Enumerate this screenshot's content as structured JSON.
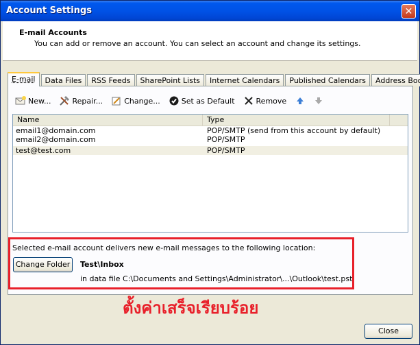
{
  "window": {
    "title": "Account Settings"
  },
  "header": {
    "title": "E-mail Accounts",
    "subtitle": "You can add or remove an account. You can select an account and change its settings."
  },
  "tabs": [
    {
      "label": "E-mail",
      "active": true
    },
    {
      "label": "Data Files"
    },
    {
      "label": "RSS Feeds"
    },
    {
      "label": "SharePoint Lists"
    },
    {
      "label": "Internet Calendars"
    },
    {
      "label": "Published Calendars"
    },
    {
      "label": "Address Books"
    }
  ],
  "toolbar": {
    "new": "New...",
    "repair": "Repair...",
    "change": "Change...",
    "set_default": "Set as Default",
    "remove": "Remove"
  },
  "list": {
    "headers": {
      "name": "Name",
      "type": "Type"
    },
    "rows": [
      {
        "name": "email1@domain.com",
        "type": "POP/SMTP (send from this account by default)"
      },
      {
        "name": "email2@domain.com",
        "type": "POP/SMTP"
      },
      {
        "name": "test@test.com",
        "type": "POP/SMTP",
        "selected": true
      }
    ]
  },
  "delivery": {
    "label": "Selected e-mail account delivers new e-mail messages to the following location:",
    "change_folder_button": "Change Folder",
    "folder": "Test\\Inbox",
    "path": "in data file C:\\Documents and Settings\\Administrator\\...\\Outlook\\test.pst"
  },
  "annotation": {
    "text": "ตั้งค่าเสร็จเรียบร้อย",
    "color": "#e8202a"
  },
  "footer": {
    "close_button": "Close"
  }
}
